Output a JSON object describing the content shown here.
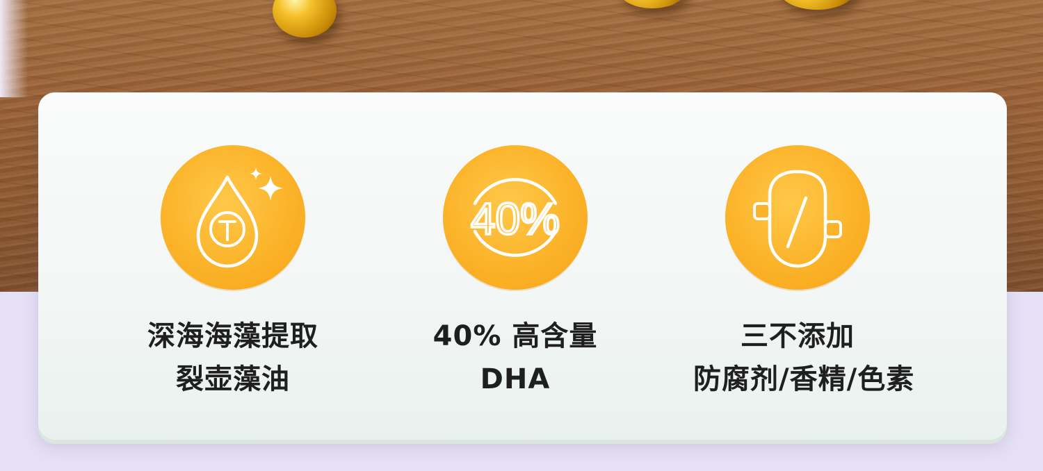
{
  "features": [
    {
      "icon": "droplet-sparkle-icon",
      "line1": "深海海藻提取",
      "line2": "裂壶藻油"
    },
    {
      "icon": "percent-badge-icon",
      "badge_text": "40%",
      "line1": "40% 高含量",
      "line2": "DHA"
    },
    {
      "icon": "no-additive-icon",
      "line1": "三不添加",
      "line2": "防腐剂/香精/色素"
    }
  ],
  "colors": {
    "badge": "#fbb329",
    "card": "#f6f8f7",
    "lavender": "#e6e0f6",
    "text": "#1f1f1f"
  }
}
